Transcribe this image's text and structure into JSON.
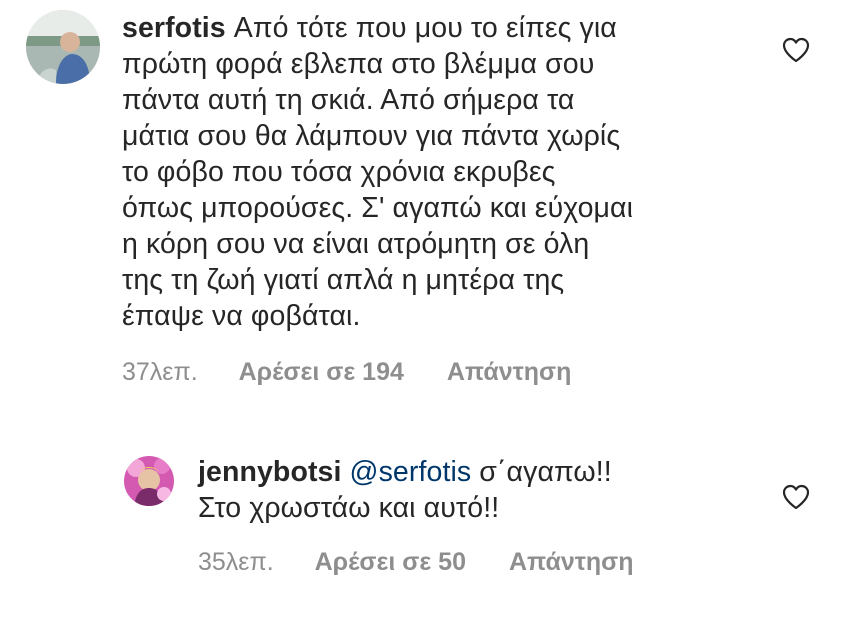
{
  "comments": [
    {
      "username": "serfotis",
      "text_lines": [
        "Από τότε που μου το είπες για",
        "πρώτη φορά εβλεπα στο βλέμμα σου",
        "πάντα αυτή τη σκιά. Από σήμερα τα",
        "μάτια σου θα λάμπουν για πάντα χωρίς",
        "το φόβο που τόσα χρόνια εκρυβες",
        "όπως μπορούσες. Σ' αγαπώ και εύχομαι",
        "η κόρη σου να είναι ατρόμητη σε όλη",
        "της τη ζωή γιατί απλά η μητέρα της",
        "έπαψε να φοβάται."
      ],
      "time": "37λεπ.",
      "likes": "Αρέσει σε 194",
      "reply": "Απάντηση",
      "like_icon": "heart-outline-icon",
      "avatar_icon": "profile-avatar"
    },
    {
      "username": "jennybotsi",
      "mention": "@serfotis",
      "text_first": " σ΄αγαπω!!",
      "text_second": "Στο χρωστάω και αυτό!!",
      "time": "35λεπ.",
      "likes": "Αρέσει σε 50",
      "reply": "Απάντηση",
      "like_icon": "heart-outline-icon",
      "avatar_icon": "profile-avatar"
    }
  ],
  "colors": {
    "text": "#262626",
    "meta": "#8e8e8e",
    "mention": "#00376b",
    "heart_stroke": "#262626"
  }
}
